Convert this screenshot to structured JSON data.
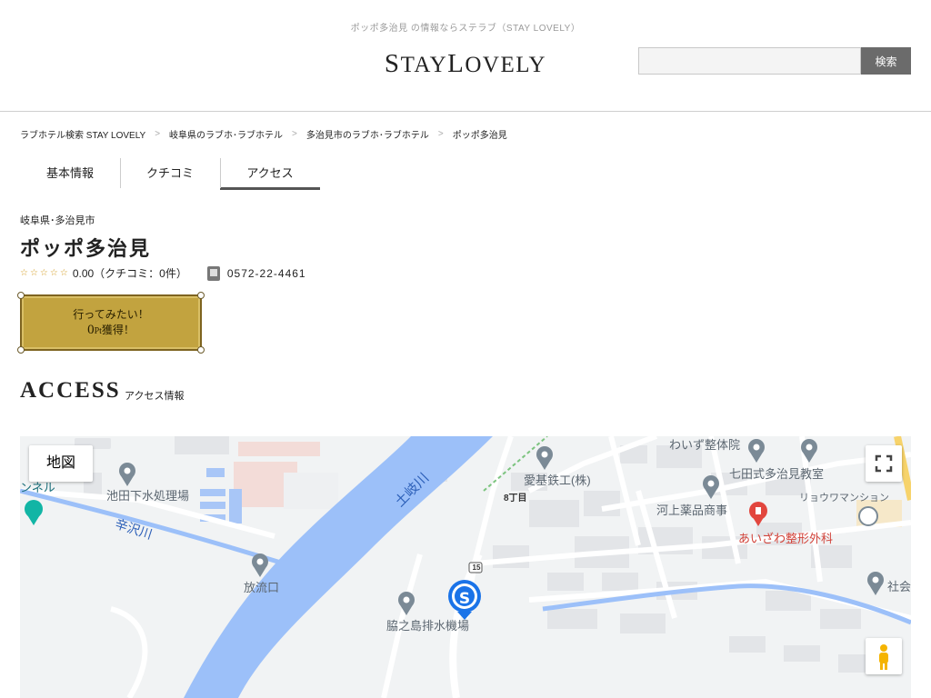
{
  "header": {
    "tagline": "ポッポ多治見 の情報ならステラブ（STAY LOVELY）",
    "logo_text": "STAYLOVELY",
    "search_placeholder": "",
    "search_button": "検索"
  },
  "breadcrumb": [
    "ラブホテル検索 STAY LOVELY",
    "岐阜県のラブホ･ラブホテル",
    "多治見市のラブホ･ラブホテル",
    "ポッポ多治見"
  ],
  "breadcrumb_separator": ">",
  "tabs": [
    {
      "label": "基本情報",
      "active": false
    },
    {
      "label": "クチコミ",
      "active": false
    },
    {
      "label": "アクセス",
      "active": true
    }
  ],
  "hotel": {
    "area": "岐阜県･多治見市",
    "name": "ポッポ多治見",
    "stars": "☆☆☆☆☆",
    "rating": "0.00（クチコミ：0件）",
    "phone": "0572-22-4461"
  },
  "want_button": {
    "line1": "行ってみたい！",
    "points": "0",
    "points_unit": "Pt",
    "line2_suffix": "獲得！"
  },
  "access": {
    "title": "ACCESS",
    "subtitle": "アクセス情報"
  },
  "map": {
    "type_button": "地図",
    "labels": {
      "tunnel": "ンネル",
      "ikeda": "池田下水処理場",
      "karasawa": "辛沢川",
      "hoyu": "放流口",
      "toki": "土岐川",
      "aiki": "愛基鉄工(株)",
      "chome": "8丁目",
      "waizu": "わいず整体院",
      "shichida": "七田式多治見教室",
      "kawakami": "河上薬品商事",
      "ryou": "リョウワマンション",
      "aizawa": "あいざわ整形外科",
      "wakino": "脇之島排水機場",
      "shakai": "社会",
      "route": "15"
    },
    "colors": {
      "land": "#f1f3f4",
      "river": "#9cc0f9",
      "road": "#ffffff",
      "block": "#e3e5e8",
      "pin": "#7b8a96",
      "pin_red": "#e2463e",
      "brand_blue": "#1a73e8"
    }
  }
}
